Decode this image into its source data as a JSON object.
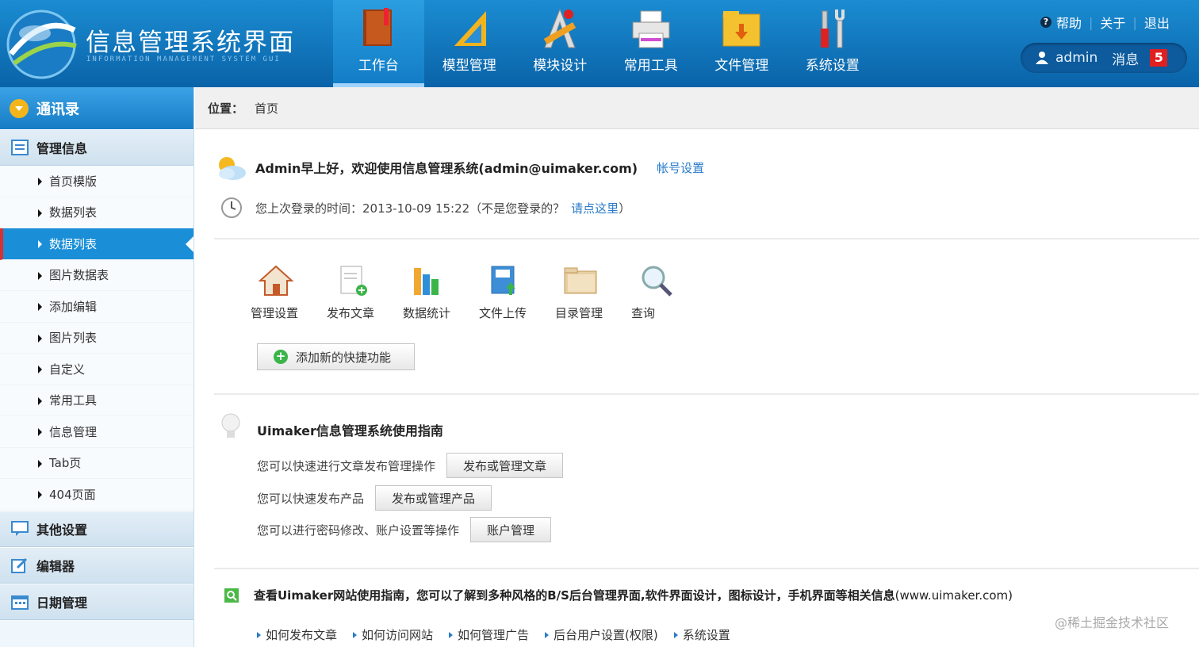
{
  "app": {
    "title": "信息管理系统界面",
    "subtitle": "INFORMATION MANAGEMENT SYSTEM GUI"
  },
  "nav": [
    {
      "label": "工作台",
      "icon": "book-icon"
    },
    {
      "label": "模型管理",
      "icon": "ruler-icon"
    },
    {
      "label": "模块设计",
      "icon": "design-tools-icon"
    },
    {
      "label": "常用工具",
      "icon": "printer-icon"
    },
    {
      "label": "文件管理",
      "icon": "folder-icon"
    },
    {
      "label": "系统设置",
      "icon": "tools-icon"
    }
  ],
  "top_links": {
    "help": "帮助",
    "about": "关于",
    "logout": "退出"
  },
  "user": {
    "name": "admin",
    "messages_label": "消息",
    "messages_count": "5"
  },
  "sidebar": {
    "header": "通讯录",
    "group1": "管理信息",
    "items": [
      "首页模版",
      "数据列表",
      "数据列表",
      "图片数据表",
      "添加编辑",
      "图片列表",
      "自定义",
      "常用工具",
      "信息管理",
      "Tab页",
      "404页面"
    ],
    "group2": "其他设置",
    "group3": "编辑器",
    "group4": "日期管理"
  },
  "breadcrumb": {
    "label": "位置：",
    "current": "首页"
  },
  "welcome": {
    "text": "Admin早上好，欢迎使用信息管理系统(admin@uimaker.com)",
    "link": "帐号设置"
  },
  "last_login": {
    "text": "您上次登录的时间：2013-10-09 15:22（不是您登录的？",
    "link": "请点这里",
    "close": "）"
  },
  "quick": [
    {
      "label": "管理设置",
      "icon": "house-icon"
    },
    {
      "label": "发布文章",
      "icon": "new-document-icon"
    },
    {
      "label": "数据统计",
      "icon": "bar-chart-icon"
    },
    {
      "label": "文件上传",
      "icon": "upload-icon"
    },
    {
      "label": "目录管理",
      "icon": "folder-icon"
    },
    {
      "label": "查询",
      "icon": "magnifier-icon"
    }
  ],
  "add_quick": "添加新的快捷功能",
  "guide": {
    "title": "Uimaker信息管理系统使用指南",
    "rows": [
      {
        "text": "您可以快速进行文章发布管理操作",
        "button": "发布或管理文章"
      },
      {
        "text": "您可以快速发布产品",
        "button": "发布或管理产品"
      },
      {
        "text": "您可以进行密码修改、账户设置等操作",
        "button": "账户管理"
      }
    ]
  },
  "site": {
    "text": "查看Uimaker网站使用指南，您可以了解到多种风格的B/S后台管理界面,软件界面设计，图标设计，手机界面等相关信息",
    "url": "(www.uimaker.com)"
  },
  "help_links": [
    "如何发布文章",
    "如何访问网站",
    "如何管理广告",
    "后台用户设置(权限)",
    "系统设置"
  ],
  "watermark": "@稀土掘金技术社区"
}
